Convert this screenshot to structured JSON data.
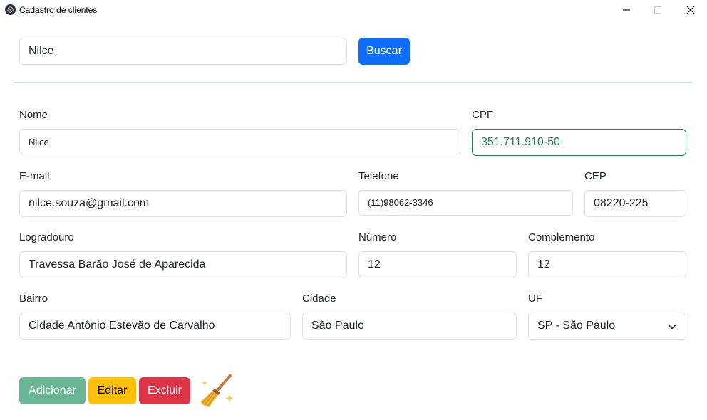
{
  "window": {
    "title": "Cadastro de clientes",
    "controls": [
      "minimize",
      "maximize",
      "close"
    ]
  },
  "search": {
    "value": "Nilce",
    "button_label": "Buscar"
  },
  "form": {
    "nome": {
      "label": "Nome",
      "value": "Nilce"
    },
    "cpf": {
      "label": "CPF",
      "value": "351.711.910-50",
      "state": "valid"
    },
    "email": {
      "label": "E-mail",
      "value": "nilce.souza@gmail.com"
    },
    "telefone": {
      "label": "Telefone",
      "value": "(11)98062-3346"
    },
    "cep": {
      "label": "CEP",
      "value": "08220-225"
    },
    "logradouro": {
      "label": "Logradouro",
      "value": "Travessa Barão José de Aparecida"
    },
    "numero": {
      "label": "Número",
      "value": "12"
    },
    "complemento": {
      "label": "Complemento",
      "value": "12"
    },
    "bairro": {
      "label": "Bairro",
      "value": "Cidade Antônio Estevão de Carvalho"
    },
    "cidade": {
      "label": "Cidade",
      "value": "São Paulo"
    },
    "uf": {
      "label": "UF",
      "value": "SP - São Paulo"
    }
  },
  "actions": {
    "add_label": "Adicionar",
    "edit_label": "Editar",
    "delete_label": "Excluir",
    "clear_icon": "broom-icon"
  },
  "colors": {
    "primary": "#0d6efd",
    "success": "#6ab594",
    "warning": "#ffc107",
    "danger": "#dc3545",
    "valid": "#198754"
  }
}
